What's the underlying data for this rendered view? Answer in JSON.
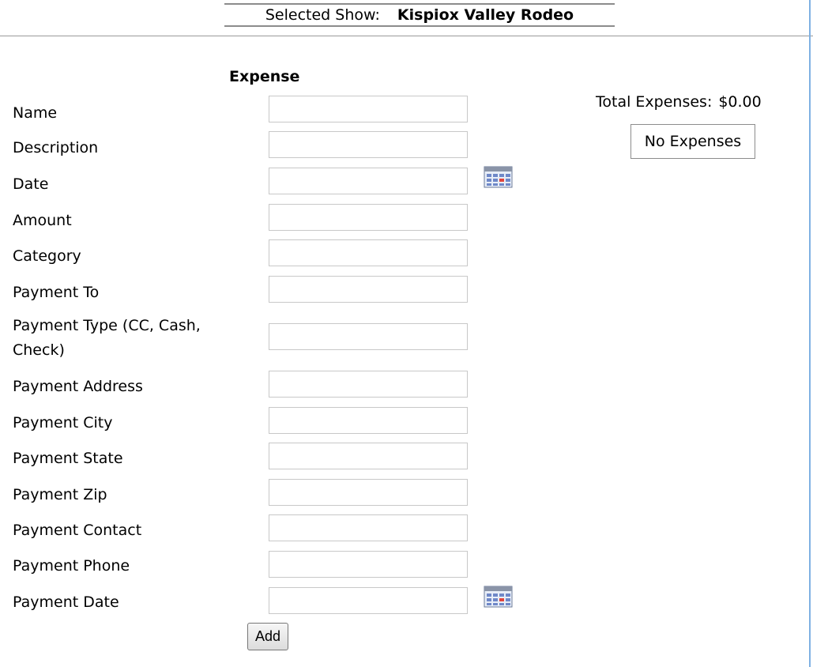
{
  "header": {
    "selected_show_label": "Selected Show:",
    "selected_show_value": "Kispiox Valley Rodeo"
  },
  "form": {
    "title": "Expense",
    "fields": [
      {
        "label": "Name",
        "value": "",
        "placeholder": ""
      },
      {
        "label": "Description",
        "value": "",
        "placeholder": ""
      },
      {
        "label": "Date",
        "value": "",
        "placeholder": "",
        "icon": "calendar-icon"
      },
      {
        "label": "Amount",
        "value": "",
        "placeholder": ""
      },
      {
        "label": "Category",
        "value": "",
        "placeholder": ""
      },
      {
        "label": "Payment To",
        "value": "",
        "placeholder": ""
      },
      {
        "label": "Payment Type (CC, Cash, Check)",
        "label_line1": "Payment Type (CC, Cash,",
        "label_line2": "Check)",
        "value": "",
        "placeholder": ""
      },
      {
        "label": "Payment Address",
        "value": "",
        "placeholder": ""
      },
      {
        "label": "Payment City",
        "value": "",
        "placeholder": ""
      },
      {
        "label": "Payment State",
        "value": "",
        "placeholder": ""
      },
      {
        "label": "Payment Zip",
        "value": "",
        "placeholder": ""
      },
      {
        "label": "Payment Contact",
        "value": "",
        "placeholder": ""
      },
      {
        "label": "Payment Phone",
        "value": "",
        "placeholder": ""
      },
      {
        "label": "Payment Date",
        "value": "",
        "placeholder": "",
        "icon": "calendar-icon"
      }
    ],
    "add_label": "Add"
  },
  "summary": {
    "total_label": "Total Expenses:",
    "total_value": "$0.00",
    "no_expenses_label": "No Expenses"
  }
}
